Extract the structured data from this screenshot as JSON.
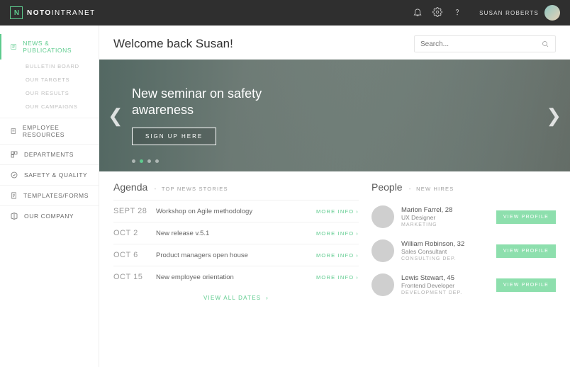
{
  "brand": {
    "name_bold": "NOTO",
    "name_light": "INTRANET"
  },
  "topbar": {
    "user_name": "SUSAN ROBERTS"
  },
  "sidebar": {
    "items": [
      {
        "label": "NEWS & PUBLICATIONS",
        "active": true,
        "sub": [
          "BULLETIN BOARD",
          "OUR TARGETS",
          "OUR RESULTS",
          "OUR CAMPAIGNS"
        ]
      },
      {
        "label": "EMPLOYEE RESOURCES"
      },
      {
        "label": "DEPARTMENTS"
      },
      {
        "label": "SAFETY & QUALITY"
      },
      {
        "label": "TEMPLATES/FORMS"
      },
      {
        "label": "OUR COMPANY"
      }
    ]
  },
  "welcome": "Welcome back Susan!",
  "search": {
    "placeholder": "Search..."
  },
  "hero": {
    "title": "New seminar on safety awareness",
    "cta": "SIGN UP HERE",
    "slide_count": 4,
    "active_slide": 1
  },
  "agenda": {
    "title": "Agenda",
    "subtitle": "TOP NEWS STORIES",
    "more_label": "MORE INFO",
    "view_all": "VIEW ALL DATES",
    "items": [
      {
        "date": "SEPT 28",
        "title": "Workshop on Agile methodology"
      },
      {
        "date": "OCT 2",
        "title": "New release v.5.1"
      },
      {
        "date": "OCT 6",
        "title": "Product managers open house"
      },
      {
        "date": "OCT 15",
        "title": "New employee orientation"
      }
    ]
  },
  "people": {
    "title": "People",
    "subtitle": "NEW HIRES",
    "view_label": "VIEW PROFILE",
    "items": [
      {
        "name": "Marion Farrel, 28",
        "role": "UX Designer",
        "dep": "MARKETING"
      },
      {
        "name": "William Robinson, 32",
        "role": "Sales Consultant",
        "dep": "CONSULTING DEP."
      },
      {
        "name": "Lewis Stewart, 45",
        "role": "Frontend Developer",
        "dep": "DEVELOPMENT DEP."
      }
    ]
  },
  "colors": {
    "accent": "#5ecb8e"
  }
}
